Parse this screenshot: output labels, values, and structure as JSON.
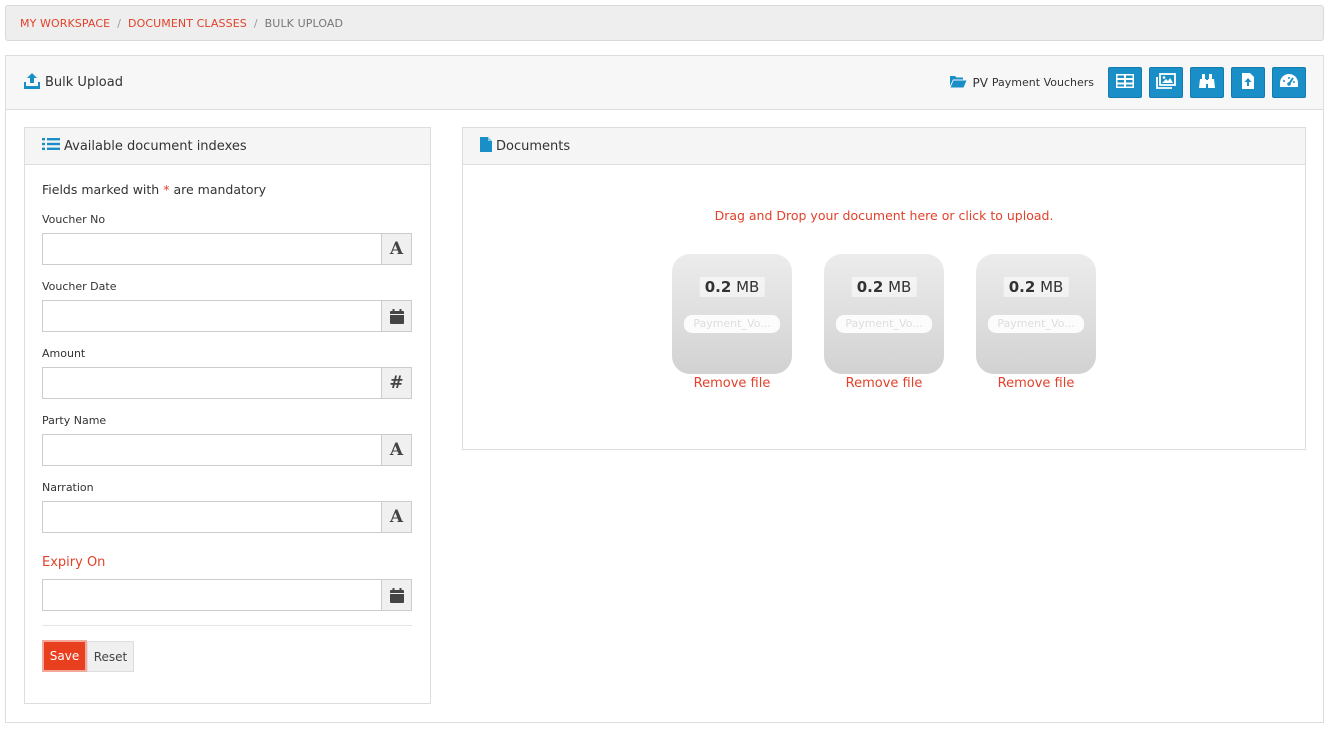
{
  "breadcrumb": {
    "items": [
      "MY WORKSPACE",
      "DOCUMENT CLASSES"
    ],
    "current": "BULK UPLOAD",
    "separator": "/"
  },
  "header": {
    "title": "Bulk Upload",
    "document_class_code": "PV",
    "document_class_name": "Payment Vouchers",
    "toolbar_icons": [
      "table-icon",
      "images-icon",
      "binoculars-icon",
      "file-upload-icon",
      "dashboard-icon"
    ]
  },
  "index_panel": {
    "title": "Available document indexes",
    "mandatory_prefix": "Fields marked with",
    "mandatory_star": "*",
    "mandatory_suffix": "are mandatory",
    "fields": [
      {
        "label": "Voucher No",
        "value": "",
        "addon": "A"
      },
      {
        "label": "Voucher Date",
        "value": "",
        "addon": "calendar-icon"
      },
      {
        "label": "Amount",
        "value": "",
        "addon": "#"
      },
      {
        "label": "Party Name",
        "value": "",
        "addon": "A"
      },
      {
        "label": "Narration",
        "value": "",
        "addon": "A"
      },
      {
        "label": "Expiry On",
        "value": "",
        "addon": "calendar-icon"
      }
    ],
    "save_label": "Save",
    "reset_label": "Reset"
  },
  "documents_panel": {
    "title": "Documents",
    "drop_text": "Drag and Drop your document here or click to upload.",
    "files": [
      {
        "size_value": "0.2",
        "size_unit": "MB",
        "name": "Payment_Vo...",
        "remove_label": "Remove file"
      },
      {
        "size_value": "0.2",
        "size_unit": "MB",
        "name": "Payment_Vo...",
        "remove_label": "Remove file"
      },
      {
        "size_value": "0.2",
        "size_unit": "MB",
        "name": "Payment_Vo...",
        "remove_label": "Remove file"
      }
    ]
  },
  "colors": {
    "accent": "#1a8fc7",
    "danger": "#e2412a",
    "save_button": "#e83f1f"
  }
}
